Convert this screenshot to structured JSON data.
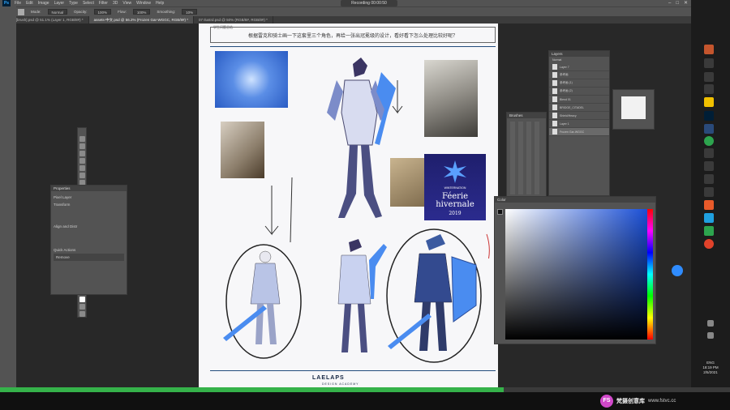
{
  "app": {
    "logo": "Ps",
    "menu": [
      "File",
      "Edit",
      "Image",
      "Layer",
      "Type",
      "Select",
      "Filter",
      "3D",
      "View",
      "Window",
      "Help"
    ],
    "recording": "Recording 00:00:50"
  },
  "options": {
    "mode_label": "Mode:",
    "mode_value": "Normal",
    "opacity_label": "Opacity:",
    "opacity_value": "100%",
    "flow_label": "Flow:",
    "flow_value": "100%",
    "smoothing_label": "Smoothing:",
    "smoothing_value": "10%"
  },
  "tabs": [
    {
      "label": "05.3.5 [brush].psd @ 51.1% (Layer 1, RGB/8#) *",
      "active": false
    },
    {
      "label": "assets-中文.psd @ 56.2% (Frozen Gar-WGGC, RGB/8#) *",
      "active": true
    },
    {
      "label": "07 Ilustrd.psd @ 50% (RGB/8#, RGB/8#) *",
      "active": false
    }
  ],
  "document": {
    "header_label": "学生问题总结",
    "header_text": "根据雷克和骑士画一下这套里三个角色，再给一张出冠冕级的设计，看好看下怎么处理比较好呢？",
    "poster_small": "WINTERNATION",
    "poster_title": "Féerie hivernale",
    "poster_year": "2019",
    "logo": "LAELAPS",
    "logo_sub": "DESIGN ACADEMY"
  },
  "panels": {
    "properties_title": "Properties",
    "properties_sub": "Pixel Layer",
    "transform_label": "Transform",
    "align_label": "Align and Distr",
    "quick_actions_label": "Quick Actions",
    "remove_label": "Remove",
    "layers_title": "Layers",
    "layers_mode": "Normal",
    "layer_names": [
      "Layer 7",
      "参考画",
      "参考画 (1)",
      "参考画 (2)",
      "Blend 01",
      "BRIDGE_CITADEL",
      "Shield/Heavy",
      "Layer 1",
      "Frozen Gar-WGGC"
    ],
    "brushes_title": "Brushes",
    "color_title": "Color"
  },
  "taskbar": {
    "lang": "ENG",
    "time": "18:19 PM",
    "date": "2/5/2021"
  },
  "progress": {
    "fraction": 0.69
  },
  "watermark": {
    "badge": "FS",
    "text": "梵摄创意库",
    "url": "www.fstvc.cc"
  },
  "colors": {
    "accent": "#31a8ff",
    "progress": "#35b24a",
    "brand_purple": "#d048c9"
  }
}
